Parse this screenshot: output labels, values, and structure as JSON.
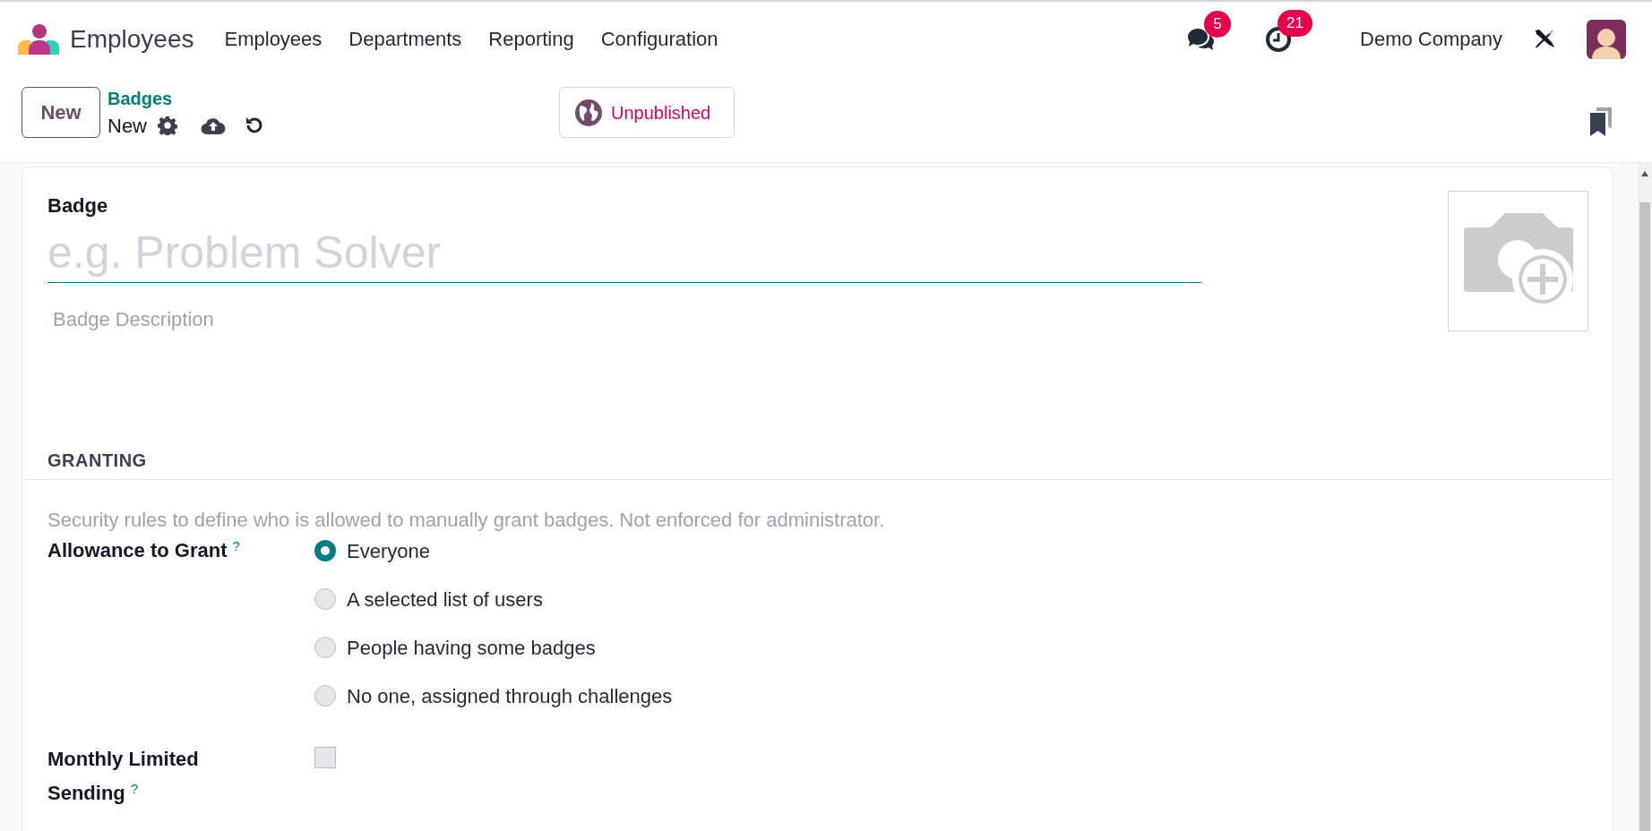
{
  "app": {
    "name": "Employees"
  },
  "menu": [
    {
      "label": "Employees"
    },
    {
      "label": "Departments"
    },
    {
      "label": "Reporting"
    },
    {
      "label": "Configuration"
    }
  ],
  "systray": {
    "messages_count": "5",
    "activities_count": "21",
    "company": "Demo Company"
  },
  "control_panel": {
    "new_button": "New",
    "breadcrumb": "Badges",
    "record_title": "New",
    "publish_status": "Unpublished"
  },
  "form": {
    "badge_label": "Badge",
    "name_placeholder": "e.g. Problem Solver",
    "description_placeholder": "Badge Description",
    "section_title": "GRANTING",
    "section_help": "Security rules to define who is allowed to manually grant badges. Not enforced for administrator.",
    "allowance": {
      "label": "Allowance to Grant",
      "help_mark": "?",
      "options": [
        {
          "label": "Everyone",
          "selected": true
        },
        {
          "label": "A selected list of users",
          "selected": false
        },
        {
          "label": "People having some badges",
          "selected": false
        },
        {
          "label": "No one, assigned through challenges",
          "selected": false
        }
      ]
    },
    "monthly_limited": {
      "label": "Monthly Limited Sending",
      "help_mark": "?",
      "checked": false
    }
  }
}
